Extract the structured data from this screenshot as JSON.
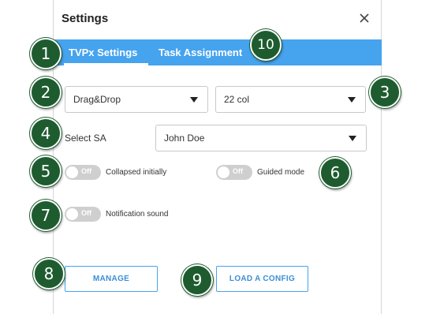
{
  "dialog": {
    "title": "Settings",
    "close_icon": "close-icon"
  },
  "tabs": [
    {
      "label": "TVPx Settings",
      "active": true
    },
    {
      "label": "Task Assignment",
      "active": false
    }
  ],
  "selects": {
    "mode": {
      "value": "Drag&Drop"
    },
    "columns": {
      "value": "22 col"
    },
    "sa": {
      "label": "Select SA",
      "value": "John Doe"
    }
  },
  "toggles": {
    "collapsed": {
      "state": "Off",
      "label": "Collapsed initially",
      "on": false
    },
    "guided": {
      "state": "Off",
      "label": "Guided mode",
      "on": false
    },
    "notification": {
      "state": "Off",
      "label": "Notification sound",
      "on": false
    }
  },
  "buttons": {
    "manage": "MANAGE",
    "load_config": "LOAD A CONFIG"
  },
  "badges": {
    "b1": "1",
    "b2": "2",
    "b3": "3",
    "b4": "4",
    "b5": "5",
    "b6": "6",
    "b7": "7",
    "b8": "8",
    "b9": "9",
    "b10": "10"
  },
  "colors": {
    "tab_bar": "#46a3ee",
    "button_border": "#46a3ee",
    "badge": "#1e5c2f",
    "toggle_off": "#cfcfcf"
  }
}
